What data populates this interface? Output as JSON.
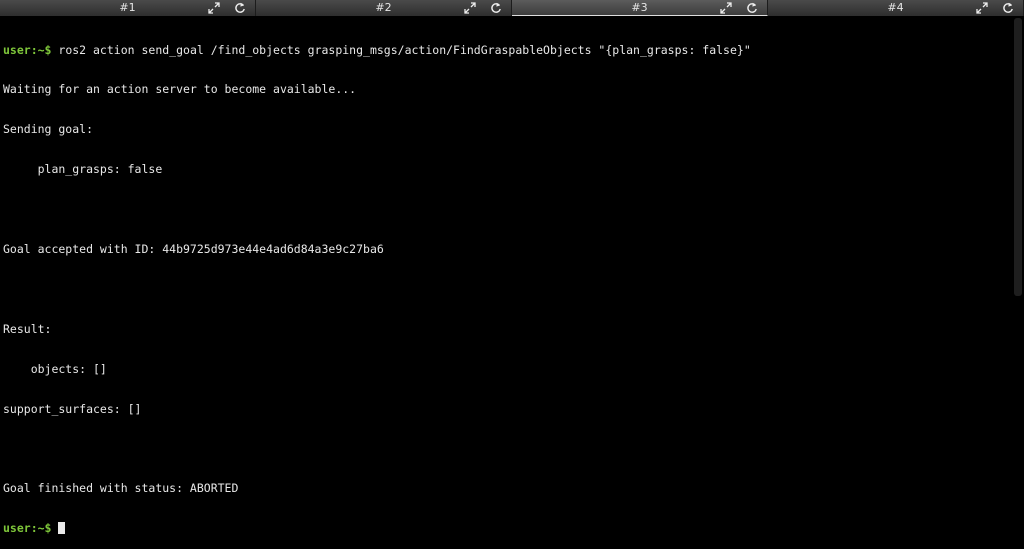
{
  "tabs": [
    {
      "label": "#1",
      "active": false
    },
    {
      "label": "#2",
      "active": false
    },
    {
      "label": "#3",
      "active": true
    },
    {
      "label": "#4",
      "active": false
    }
  ],
  "icons": {
    "maximize": "maximize-icon",
    "reload": "reload-icon"
  },
  "terminal": {
    "prompt": "user:~$",
    "command": " ros2 action send_goal /find_objects grasping_msgs/action/FindGraspableObjects \"{plan_grasps: false}\"",
    "output": [
      "Waiting for an action server to become available...",
      "Sending goal:",
      "     plan_grasps: false",
      "",
      "Goal accepted with ID: 44b9725d973e44e4ad6d84a3e9c27ba6",
      "",
      "Result:",
      "    objects: []",
      "support_surfaces: []",
      "",
      "Goal finished with status: ABORTED"
    ],
    "final_prompt": "user:~$"
  },
  "colors": {
    "prompt": "#7ec63a",
    "text": "#e8e8e8",
    "background": "#000000"
  }
}
